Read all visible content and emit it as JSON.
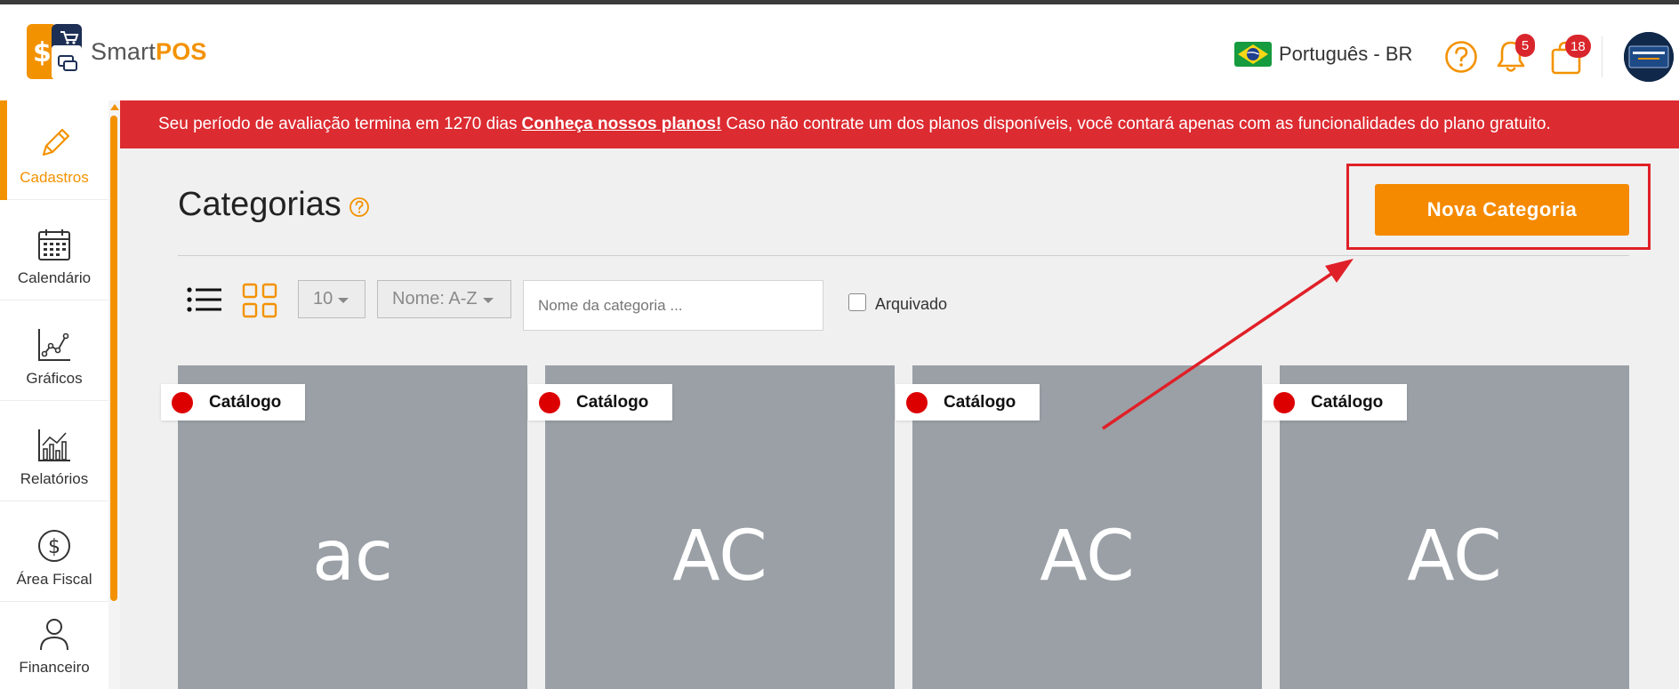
{
  "app": {
    "name_part1": "Smart",
    "name_part2": "POS",
    "brand_color": "#f39200"
  },
  "header": {
    "language": "Português - BR",
    "notifications_count": "5",
    "cart_count": "18"
  },
  "sidebar": {
    "items": [
      {
        "label": "Cadastros",
        "icon": "pencil-icon",
        "active": true
      },
      {
        "label": "Calendário",
        "icon": "calendar-icon"
      },
      {
        "label": "Gráficos",
        "icon": "line-chart-icon"
      },
      {
        "label": "Relatórios",
        "icon": "bar-chart-icon"
      },
      {
        "label": "Área Fiscal",
        "icon": "dollar-circle-icon"
      },
      {
        "label": "Financeiro",
        "icon": "person-icon"
      }
    ]
  },
  "banner": {
    "text_before": "Seu período de avaliação termina em 1270 dias",
    "link": "Conheça nossos planos!",
    "text_after": "Caso não contrate um dos planos disponíveis, você contará apenas com as funcionalidades do plano gratuito.",
    "color": "#dc2b31"
  },
  "page": {
    "title": "Categorias",
    "new_button": "Nova Categoria"
  },
  "toolbar": {
    "page_size": "10",
    "sort": "Nome: A-Z",
    "search_placeholder": "Nome da categoria ...",
    "archived_label": "Arquivado"
  },
  "cards": [
    {
      "tag": "Catálogo",
      "initials": "ac"
    },
    {
      "tag": "Catálogo",
      "initials": "AC"
    },
    {
      "tag": "Catálogo",
      "initials": "AC"
    },
    {
      "tag": "Catálogo",
      "initials": "AC"
    }
  ]
}
